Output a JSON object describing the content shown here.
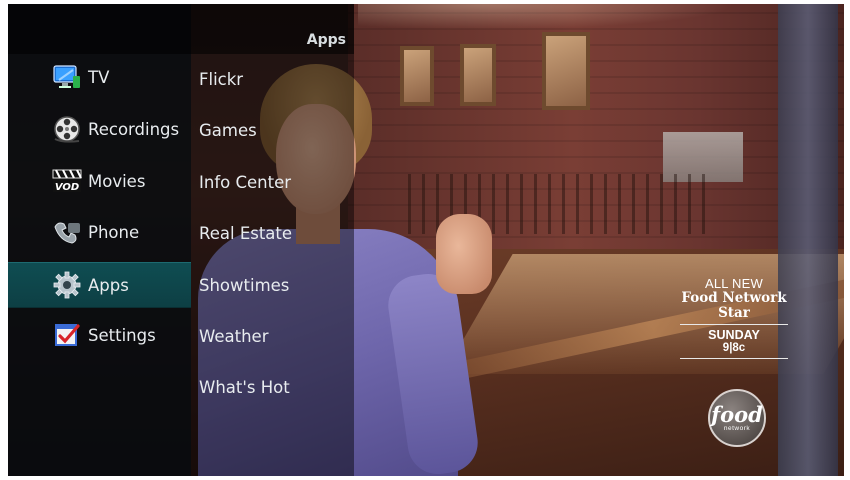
{
  "menu": {
    "title": "Apps",
    "main_items": [
      {
        "label": "TV",
        "icon": "tv-monitor-icon"
      },
      {
        "label": "Recordings",
        "icon": "film-reel-icon"
      },
      {
        "label": "Movies",
        "icon": "vod-clapper-icon"
      },
      {
        "label": "Phone",
        "icon": "phone-icon"
      },
      {
        "label": "Apps",
        "icon": "gear-icon",
        "selected": true
      },
      {
        "label": "Settings",
        "icon": "checkbox-icon"
      }
    ],
    "sub_items": [
      "Flickr",
      "Games",
      "Info Center",
      "Real Estate",
      "Showtimes",
      "Weather",
      "What's Hot"
    ]
  },
  "ad": {
    "headline": "ALL NEW",
    "show_line1": "Food Network",
    "show_line2": "Star",
    "day": "SUNDAY",
    "time": "9|8c",
    "logo_word": "food",
    "logo_sub": "network"
  },
  "colors": {
    "selected_bg": "#0f4d52",
    "menu_bg": "#060a0e",
    "text": "#e8ecef"
  },
  "vod_icon_text": "VOD"
}
